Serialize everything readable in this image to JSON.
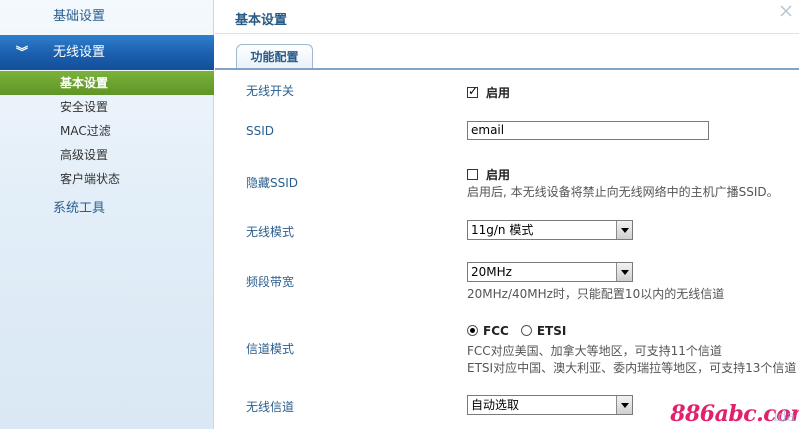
{
  "sidebar": {
    "groups": [
      {
        "label": "基础设置"
      },
      {
        "label": "无线设置",
        "chevron": "»"
      },
      {
        "label": "系统工具"
      }
    ],
    "wireless_items": [
      {
        "label": "基本设置"
      },
      {
        "label": "安全设置"
      },
      {
        "label": "MAC过滤"
      },
      {
        "label": "高级设置"
      },
      {
        "label": "客户端状态"
      }
    ]
  },
  "main": {
    "title": "基本设置",
    "tab": "功能配置",
    "wireless_switch": {
      "label": "无线开关",
      "option": "启用",
      "checked": true
    },
    "ssid": {
      "label": "SSID",
      "value": "email"
    },
    "hide_ssid": {
      "label": "隐藏SSID",
      "option": "启用",
      "checked": false,
      "hint": "启用后, 本无线设备将禁止向无线网络中的主机广播SSID。"
    },
    "wireless_mode": {
      "label": "无线模式",
      "selected": "11g/n 模式"
    },
    "bandwidth": {
      "label": "频段带宽",
      "selected": "20MHz",
      "hint": "20MHz/40MHz时，只能配置10以内的无线信道"
    },
    "channel_mode": {
      "label": "信道模式",
      "options": [
        "FCC",
        "ETSI"
      ],
      "selected": "FCC",
      "hint1": "FCC对应美国、加拿大等地区，可支持11个信道",
      "hint2": "ETSI对应中国、澳大利亚、委内瑞拉等地区，可支持13个信道"
    },
    "channel": {
      "label": "无线信道",
      "selected": "自动选取"
    }
  },
  "watermark": {
    "text": "886abc.com",
    "faded": "ida"
  },
  "colors": {
    "active_nav": "#1a5fae",
    "active_sub": "#6aa12e",
    "label_blue": "#2b5e8e",
    "watermark": "#e2206c"
  }
}
